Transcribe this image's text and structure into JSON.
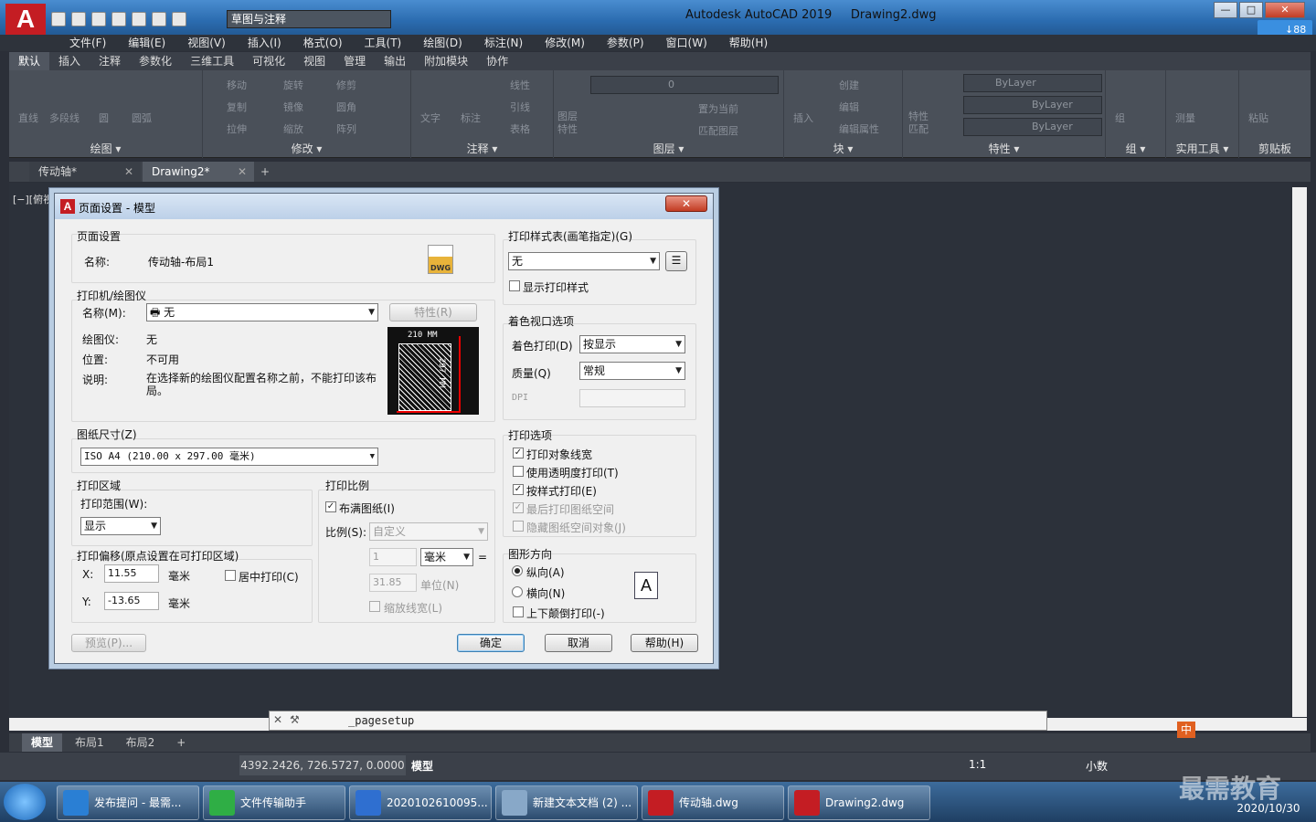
{
  "app": {
    "logo": "A",
    "workspace": "草图与注释",
    "title": "Autodesk AutoCAD 2019",
    "filename": "Drawing2.dwg",
    "win_min": "—",
    "win_max": "□",
    "win_close": "✕",
    "cloud_badge": "↓88"
  },
  "menubar": [
    "文件(F)",
    "编辑(E)",
    "视图(V)",
    "插入(I)",
    "格式(O)",
    "工具(T)",
    "绘图(D)",
    "标注(N)",
    "修改(M)",
    "参数(P)",
    "窗口(W)",
    "帮助(H)"
  ],
  "ribbon_tabs": [
    "默认",
    "插入",
    "注释",
    "参数化",
    "三维工具",
    "可视化",
    "视图",
    "管理",
    "输出",
    "附加模块",
    "协作"
  ],
  "ribbon": {
    "draw": {
      "title": "绘图 ▾",
      "items": [
        "直线",
        "多段线",
        "圆",
        "圆弧"
      ]
    },
    "modify": {
      "title": "修改 ▾",
      "items": [
        "移动",
        "旋转",
        "修剪",
        "复制",
        "镜像",
        "圆角",
        "拉伸",
        "缩放",
        "阵列"
      ]
    },
    "annotate": {
      "title": "注释 ▾",
      "items": [
        "文字",
        "标注",
        "线性",
        "引线",
        "表格"
      ]
    },
    "layers": {
      "title": "图层 ▾",
      "layer_value": "0",
      "items": [
        "图层特性",
        "置为当前",
        "匹配图层"
      ]
    },
    "block": {
      "title": "块 ▾",
      "items": [
        "插入",
        "创建",
        "编辑",
        "编辑属性"
      ]
    },
    "properties": {
      "title": "特性 ▾",
      "bylayer1": "ByLayer",
      "bylayer2": "ByLayer",
      "bylayer3": "ByLayer",
      "items": [
        "特性匹配"
      ]
    },
    "groups": {
      "title": "组 ▾",
      "items": [
        "组"
      ]
    },
    "utilities": {
      "title": "实用工具 ▾",
      "items": [
        "测量"
      ]
    },
    "clipboard": {
      "title": "剪贴板",
      "items": [
        "粘贴"
      ]
    }
  },
  "doc_tabs": [
    {
      "label": "传动轴*",
      "active": false
    },
    {
      "label": "Drawing2*",
      "active": true
    }
  ],
  "doc_tab_close": "✕",
  "doc_tab_add": "+",
  "view_label": "[−][俯视",
  "dialog": {
    "title": "页面设置 - 模型",
    "close": "✕",
    "page_setup": {
      "group": "页面设置",
      "name_label": "名称:",
      "name_value": "传动轴-布局1",
      "dwg": "DWG"
    },
    "printer": {
      "group": "打印机/绘图仪",
      "name_label": "名称(M):",
      "name_value": "无",
      "properties_btn": "特性(R)",
      "plotter_label": "绘图仪:",
      "plotter_value": "无",
      "location_label": "位置:",
      "location_value": "不可用",
      "desc_label": "说明:",
      "desc_value": "在选择新的绘图仪配置名称之前，不能打印该布局。",
      "dim_w": "210 MM",
      "dim_h": "297 MM"
    },
    "paper_size": {
      "group": "图纸尺寸(Z)",
      "value": "ISO A4 (210.00 x 297.00 毫米)"
    },
    "plot_area": {
      "group": "打印区域",
      "range_label": "打印范围(W):",
      "range_value": "显示"
    },
    "plot_offset": {
      "group": "打印偏移(原点设置在可打印区域)",
      "x_label": "X:",
      "x_value": "11.55",
      "x_unit": "毫米",
      "y_label": "Y:",
      "y_value": "-13.65",
      "y_unit": "毫米",
      "center": "居中打印(C)"
    },
    "plot_scale": {
      "group": "打印比例",
      "fit": "布满图纸(I)",
      "scale_label": "比例(S):",
      "scale_value": "自定义",
      "v1": "1",
      "unit": "毫米",
      "eq": "=",
      "v2": "31.85",
      "unit2": "单位(N)",
      "lineweights": "缩放线宽(L)"
    },
    "style_table": {
      "group": "打印样式表(画笔指定)(G)",
      "value": "无",
      "show": "显示打印样式"
    },
    "shaded": {
      "group": "着色视口选项",
      "shade_label": "着色打印(D)",
      "shade_value": "按显示",
      "quality_label": "质量(Q)",
      "quality_value": "常规",
      "dpi_label": "DPI"
    },
    "options": {
      "group": "打印选项",
      "items": [
        {
          "label": "打印对象线宽",
          "checked": true,
          "disabled": false
        },
        {
          "label": "使用透明度打印(T)",
          "checked": false,
          "disabled": false
        },
        {
          "label": "按样式打印(E)",
          "checked": true,
          "disabled": false
        },
        {
          "label": "最后打印图纸空间",
          "checked": true,
          "disabled": true
        },
        {
          "label": "隐藏图纸空间对象(J)",
          "checked": false,
          "disabled": true
        }
      ]
    },
    "orientation": {
      "group": "图形方向",
      "portrait": "纵向(A)",
      "landscape": "横向(N)",
      "upside": "上下颠倒打印(-)",
      "icon": "A"
    },
    "buttons": {
      "preview": "预览(P)...",
      "ok": "确定",
      "cancel": "取消",
      "help": "帮助(H)"
    }
  },
  "command": {
    "value": "_pagesetup"
  },
  "layout_tabs": [
    {
      "label": "模型",
      "active": true
    },
    {
      "label": "布局1",
      "active": false
    },
    {
      "label": "布局2",
      "active": false
    }
  ],
  "layout_tab_add": "+",
  "status": {
    "coords": "4392.2426, 726.5727, 0.0000",
    "model": "模型",
    "scale": "1:1",
    "units": "小数"
  },
  "taskbar": {
    "items": [
      "发布提问 - 最需...",
      "文件传输助手",
      "2020102610095...",
      "新建文本文档 (2) ...",
      "传动轴.dwg",
      "Drawing2.dwg"
    ],
    "ime": "中",
    "time": "2020/10/30",
    "watermark": "最需教育"
  },
  "colors": {
    "accent": "#c41d23",
    "ribbon": "#4a5059",
    "canvas": "#2c313a"
  }
}
